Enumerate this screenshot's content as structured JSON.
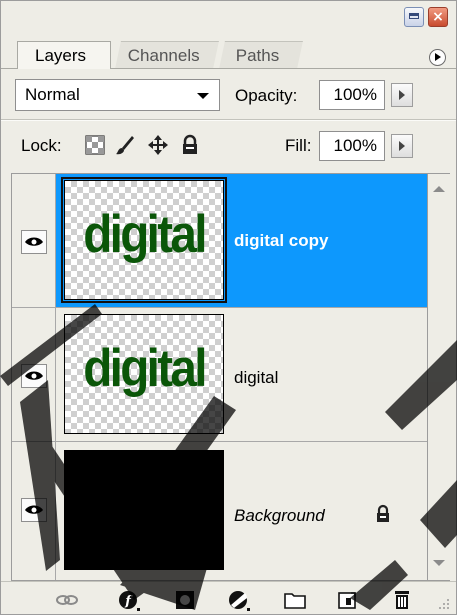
{
  "tabs": [
    {
      "label": "Layers",
      "active": true
    },
    {
      "label": "Channels",
      "active": false
    },
    {
      "label": "Paths",
      "active": false
    }
  ],
  "blend_mode": {
    "value": "Normal"
  },
  "opacity": {
    "label": "Opacity:",
    "value": "100%"
  },
  "lock": {
    "label": "Lock:",
    "icons": [
      "lock-transparent-pixels-icon",
      "lock-image-pixels-icon",
      "lock-position-icon",
      "lock-all-icon"
    ]
  },
  "fill": {
    "label": "Fill:",
    "value": "100%"
  },
  "layers": [
    {
      "name": "digital copy",
      "visible": true,
      "selected": true,
      "thumbnail_text": "digital"
    },
    {
      "name": "digital",
      "visible": true,
      "selected": false,
      "thumbnail_text": "digital"
    },
    {
      "name": "Background",
      "visible": true,
      "selected": false,
      "locked": true
    }
  ],
  "bottom_icons": [
    "link-layers-icon",
    "layer-style-icon",
    "layer-mask-icon",
    "adjustment-layer-icon",
    "new-group-icon",
    "new-layer-icon",
    "delete-layer-icon"
  ],
  "colors": {
    "selection": "#0d98fd",
    "panel": "#eeede6",
    "thumbnail_text": "#0a5608"
  }
}
